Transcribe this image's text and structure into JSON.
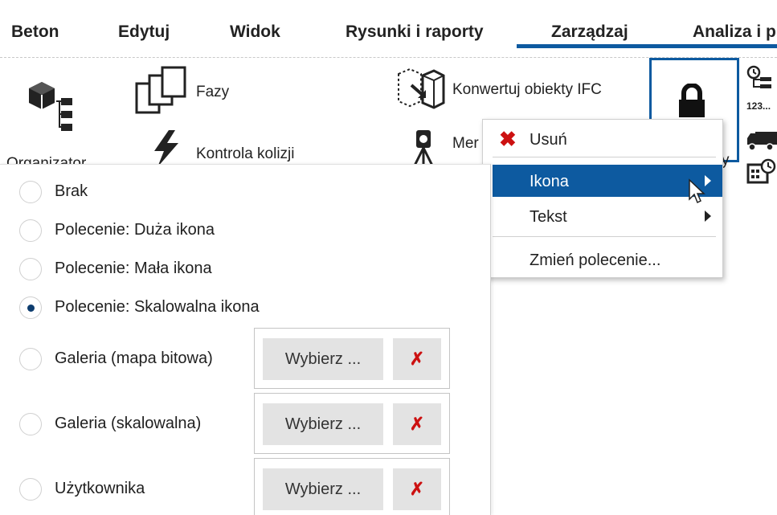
{
  "tabs": [
    {
      "label": "Beton"
    },
    {
      "label": "Edytuj"
    },
    {
      "label": "Widok"
    },
    {
      "label": "Rysunki i raporty"
    },
    {
      "label": "Zarządzaj",
      "active": true
    },
    {
      "label": "Analiza i p"
    }
  ],
  "ribbon": {
    "organizer_label": "Organizator",
    "phases_label": "Fazy",
    "clash_label": "Kontrola kolizji",
    "ifc_label": "Konwertuj obiekty IFC",
    "measure_label": "Mer",
    "partial_label": "y",
    "small_label": "123..."
  },
  "context_menu": {
    "items": [
      {
        "label": "Usuń",
        "icon": "delete-x-icon"
      },
      {
        "label": "Ikona",
        "submenu": true,
        "highlighted": true
      },
      {
        "label": "Tekst",
        "submenu": true
      },
      {
        "label": "Zmień polecenie..."
      }
    ]
  },
  "icon_options": {
    "options": [
      {
        "label": "Brak",
        "selected": false
      },
      {
        "label": "Polecenie: Duża ikona",
        "selected": false
      },
      {
        "label": "Polecenie: Mała ikona",
        "selected": false
      },
      {
        "label": "Polecenie: Skalowalna ikona",
        "selected": true
      },
      {
        "label": "Galeria (mapa bitowa)",
        "selected": false,
        "choose_label": "Wybierz ...",
        "clear_label": "✗"
      },
      {
        "label": "Galeria (skalowalna)",
        "selected": false,
        "choose_label": "Wybierz ...",
        "clear_label": "✗"
      },
      {
        "label": "Użytkownika",
        "selected": false,
        "choose_label": "Wybierz ...",
        "clear_label": "✗"
      }
    ]
  },
  "colors": {
    "accent": "#0d5aa0",
    "delete_red": "#cc1111",
    "button_gray": "#e3e3e3"
  }
}
